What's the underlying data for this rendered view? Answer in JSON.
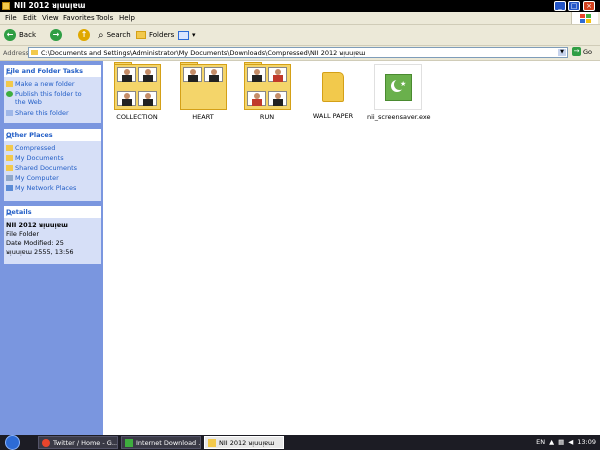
{
  "window": {
    "title": "NII 2012 ᴚᴉuuᴉɐɯ",
    "minimize": "_",
    "maximize": "□",
    "close": "×"
  },
  "menu": [
    "File",
    "Edit",
    "View",
    "Favorites",
    "Tools",
    "Help"
  ],
  "toolbar": {
    "back": "Back",
    "search": "Search",
    "folders": "Folders",
    "back_glyph": "←",
    "forward_glyph": "→",
    "up_glyph": "↑",
    "view_glyph": "▾"
  },
  "address": {
    "label": "Address",
    "value": "C:\\Documents and Settings\\Administrator\\My Documents\\Downloads\\Compressed\\NII 2012 ᴚᴉuuᴉɐɯ",
    "go": "Go"
  },
  "tasks": {
    "title": "File and Folder Tasks",
    "items": [
      "Make a new folder",
      "Publish this folder to the Web",
      "Share this folder"
    ]
  },
  "places": {
    "title": "Other Places",
    "items": [
      "Compressed",
      "My Documents",
      "Shared Documents",
      "My Computer",
      "My Network Places"
    ]
  },
  "details": {
    "title": "Details",
    "name": "NII 2012 ᴚᴉuuᴉɐɯ",
    "type": "File Folder",
    "modified": "Date Modified: 25 ᴚᴉuuᴉɐɯ 2555, 13:56"
  },
  "files": [
    {
      "name": "COLLECTION",
      "kind": "photo-folder"
    },
    {
      "name": "HEART",
      "kind": "photo-folder"
    },
    {
      "name": "RUN",
      "kind": "photo-folder"
    },
    {
      "name": "WALL PAPER",
      "kind": "plain-folder"
    },
    {
      "name": "nii_screensaver.exe",
      "kind": "exe"
    }
  ],
  "taskbar": {
    "items": [
      "Twitter / Home - G...",
      "Internet Download ...",
      "NII 2012 ᴚᴉuuᴉɐɯ"
    ],
    "tray_lang": "EN",
    "time": "13:09"
  },
  "colors": {
    "sidebar_bg": "#7a96df",
    "panel_bg": "#d6dff7",
    "link": "#215dc6",
    "folder": "#f2c94c",
    "taskbar": "#1c1c24"
  }
}
